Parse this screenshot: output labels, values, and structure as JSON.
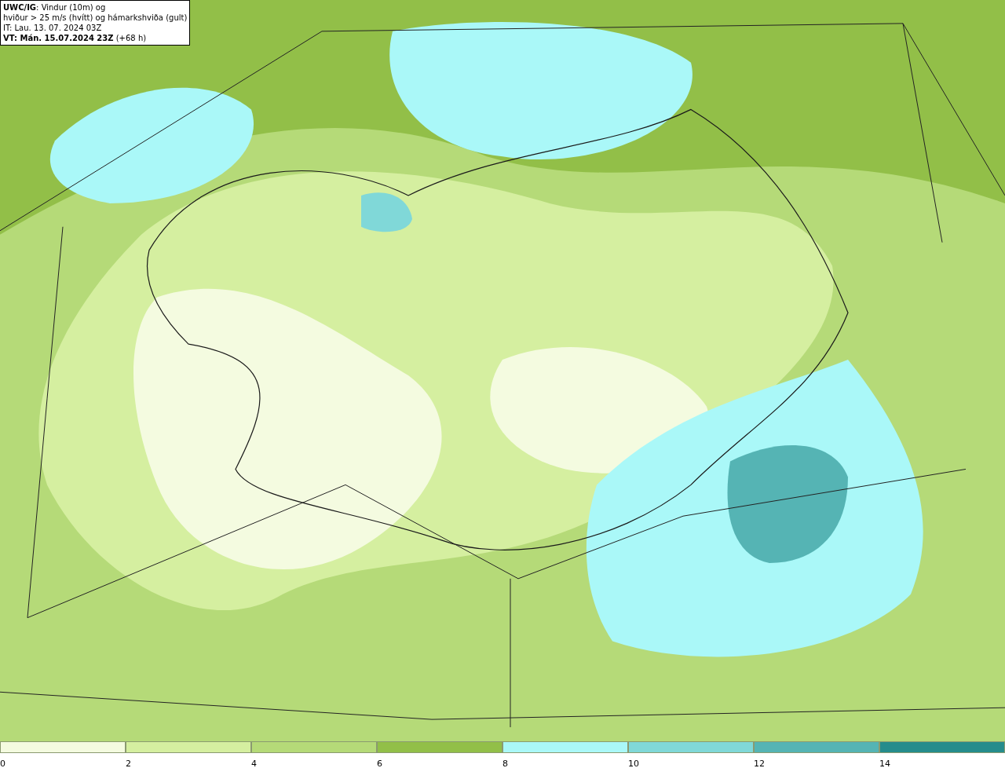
{
  "legend": {
    "lines": [
      "**UWC/IG**: Vindur (10m) og",
      "hviður > 25 m/s (hvítt) og hámarkshviða (gult)",
      "IT: Lau. 13. 07. 2024 03Z",
      "**VT: Mán. 15.07.2024 23Z** (+68 h)"
    ]
  },
  "colorbar": {
    "bins": [
      {
        "color": "#f4fbe0"
      },
      {
        "color": "#d5efa0"
      },
      {
        "color": "#b5da78"
      },
      {
        "color": "#92bf48"
      },
      {
        "color": "#aaf8f8"
      },
      {
        "color": "#80d8d8"
      },
      {
        "color": "#55b4b4"
      },
      {
        "color": "#258c8c"
      }
    ],
    "ticks": [
      "0",
      "2",
      "4",
      "6",
      "8",
      "10",
      "12",
      "14"
    ]
  }
}
